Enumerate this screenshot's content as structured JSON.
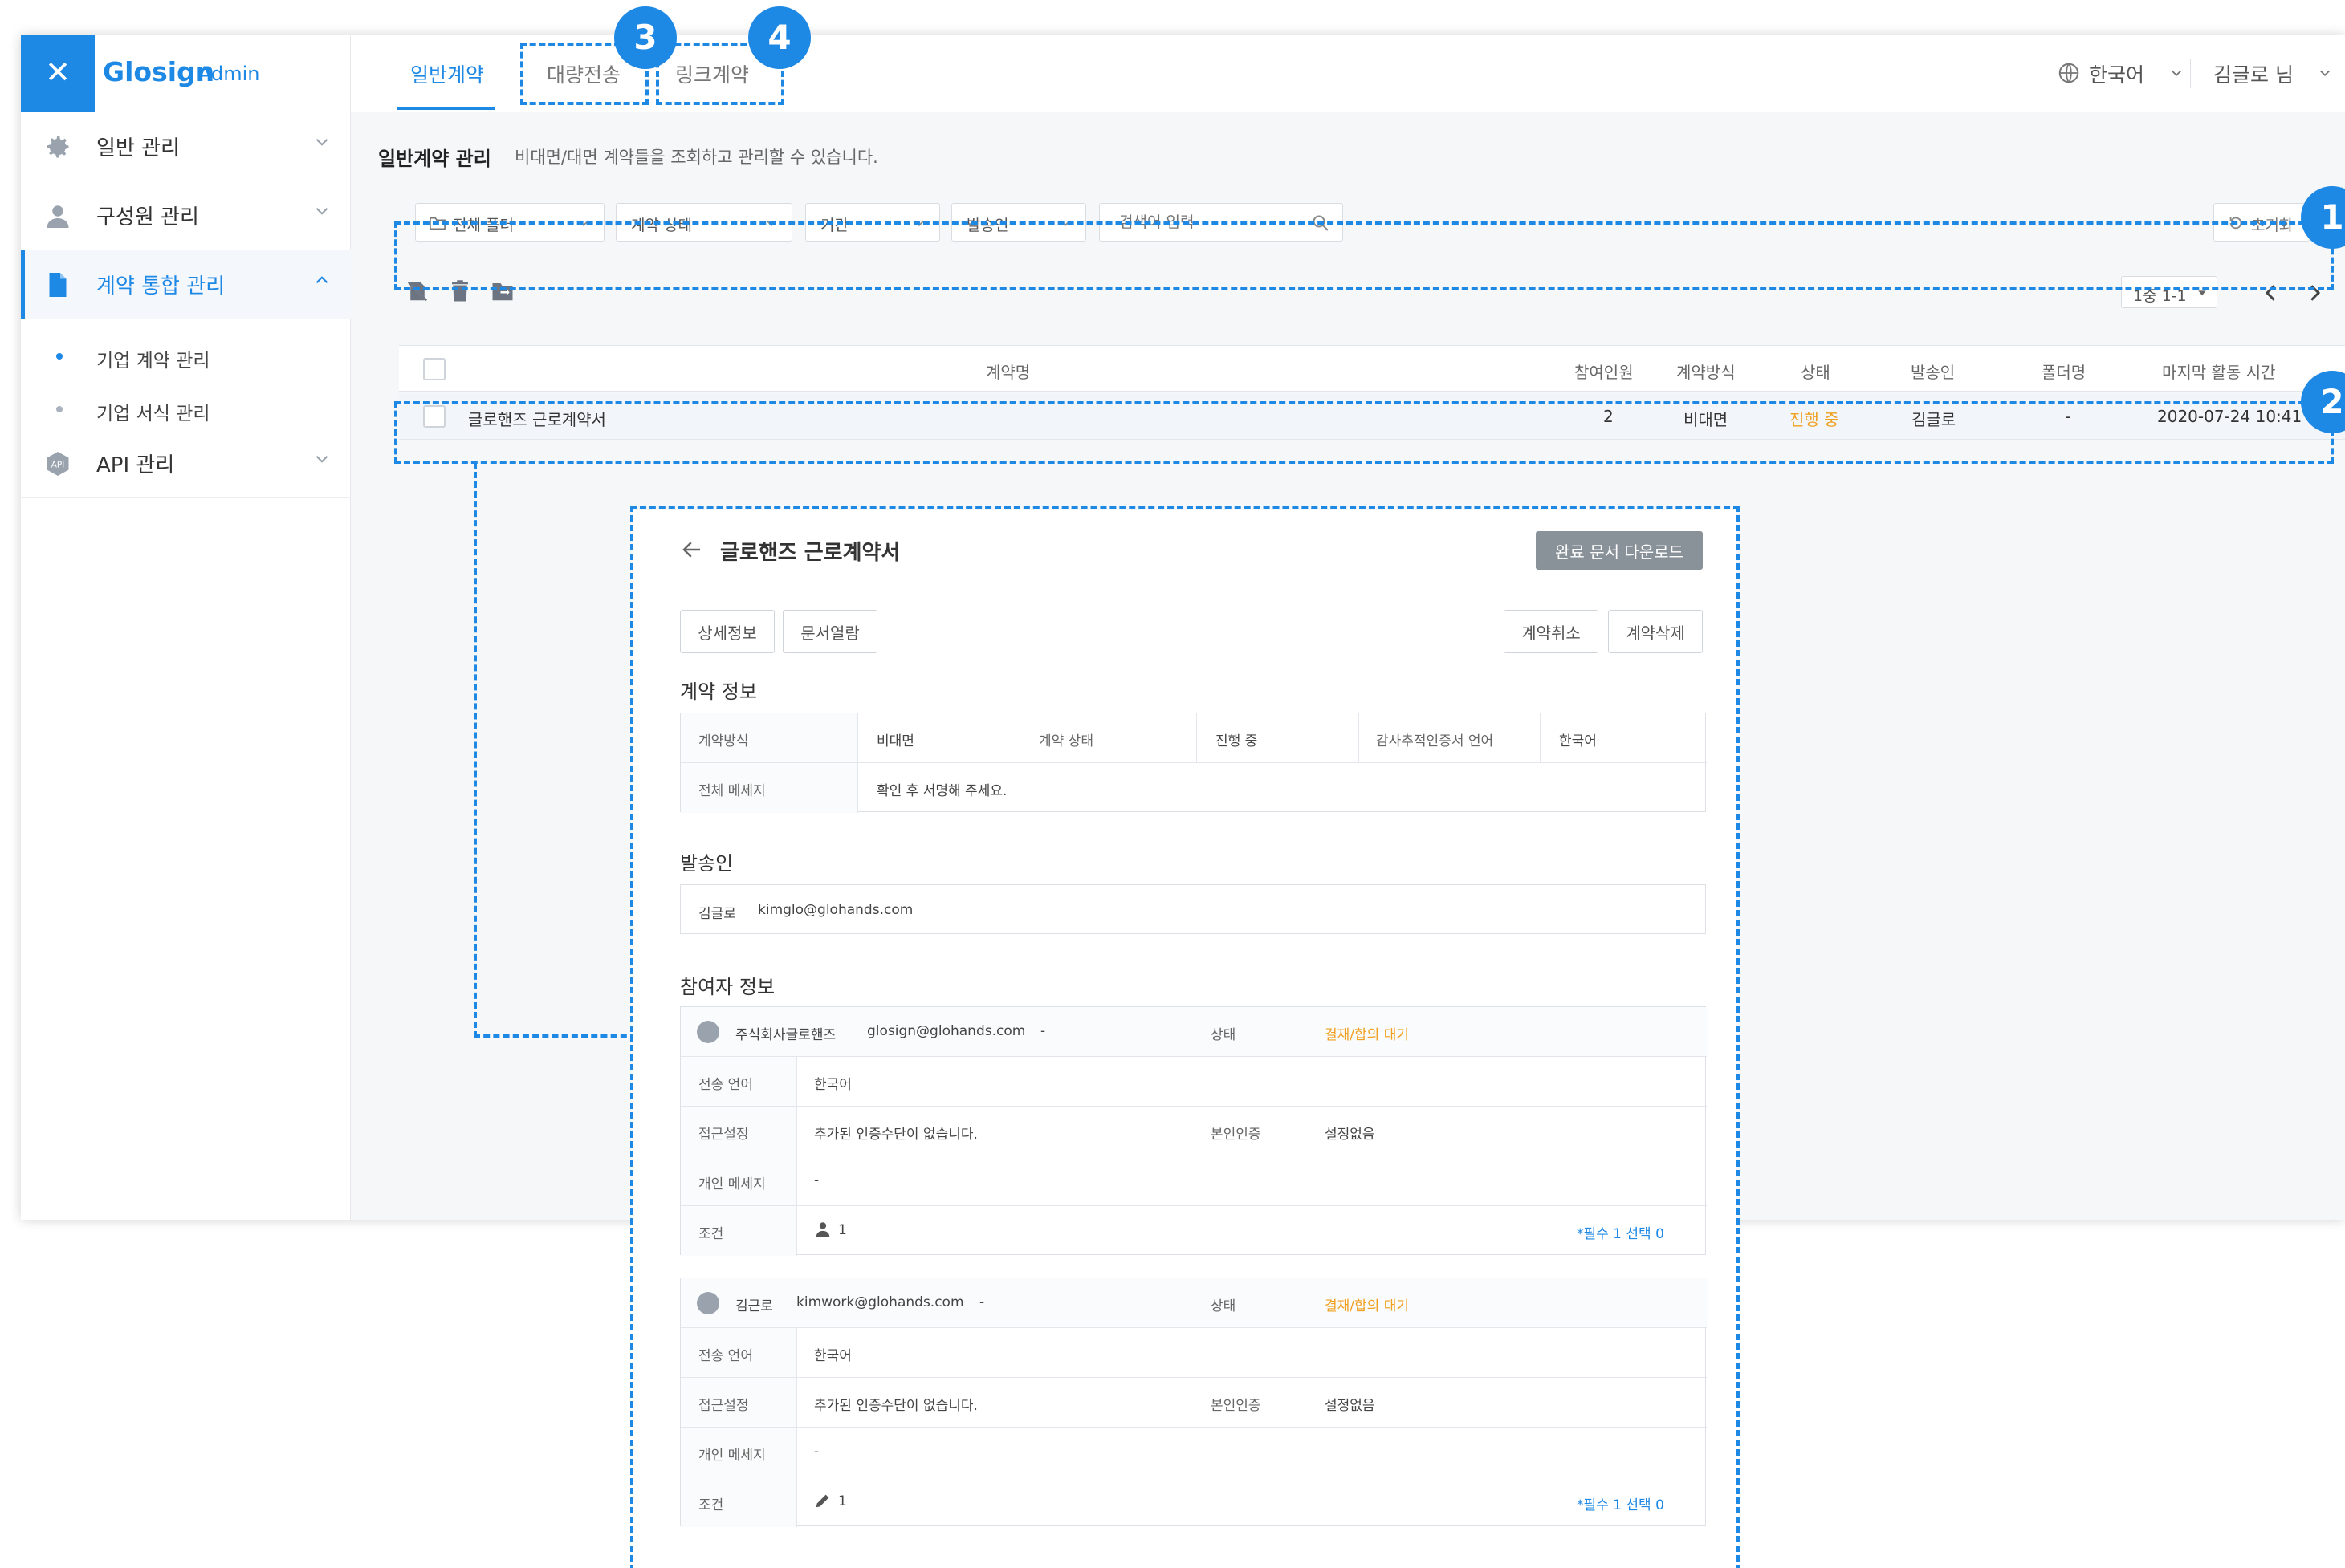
{
  "brand": {
    "close_glyph": "✕",
    "logo": "Glosign",
    "sub": "Admin"
  },
  "sidebar": {
    "items": [
      {
        "label": "일반 관리",
        "icon": "gear-icon"
      },
      {
        "label": "구성원 관리",
        "icon": "person-icon"
      },
      {
        "label": "계약 통합 관리",
        "icon": "document-icon",
        "active": true
      },
      {
        "label": "API 관리",
        "icon": "api-icon"
      }
    ],
    "sub_items": [
      {
        "label": "기업 계약 관리",
        "active": true
      },
      {
        "label": "기업 서식 관리"
      }
    ]
  },
  "topnav": {
    "tabs": [
      "일반계약",
      "대량전송",
      "링크계약"
    ],
    "language": "한국어",
    "user": "김글로 님"
  },
  "page": {
    "title": "일반계약 관리",
    "description": "비대면/대면 계약들을 조회하고 관리할 수 있습니다."
  },
  "filters": {
    "folder": "전체 폴더",
    "status": "계약 상태",
    "period": "기간",
    "sender": "발송인",
    "search_placeholder": "검색어 입력",
    "reset": "초기화"
  },
  "pager": {
    "label": "1중 1-1"
  },
  "table": {
    "headers": [
      "계약명",
      "참여인원",
      "계약방식",
      "상태",
      "발송인",
      "폴더명",
      "마지막 활동 시간"
    ],
    "rows": [
      {
        "name": "글로핸즈 근로계약서",
        "participants": "2",
        "method": "비대면",
        "status": "진행 중",
        "sender": "김글로",
        "folder": "-",
        "last_activity": "2020-07-24 10:41"
      }
    ]
  },
  "annotations": [
    "1",
    "2",
    "3",
    "4"
  ],
  "detail": {
    "title": "글로핸즈 근로계약서",
    "download": "완료 문서 다운로드",
    "buttons": {
      "info": "상세정보",
      "view": "문서열람",
      "cancel": "계약취소",
      "delete": "계약삭제"
    },
    "contract_section": "계약 정보",
    "contract": {
      "method_label": "계약방식",
      "method": "비대면",
      "status_label": "계약 상태",
      "status": "진행 중",
      "cert_lang_label": "감사추적인증서 언어",
      "cert_lang": "한국어",
      "message_label": "전체 메세지",
      "message": "확인 후 서명해 주세요."
    },
    "sender_section": "발송인",
    "sender": {
      "name": "김글로",
      "email": "kimglo@glohands.com"
    },
    "participants_section": "참여자 정보",
    "participants": [
      {
        "name": "주식회사글로핸즈",
        "email": "glosign@glohands.com",
        "dash": "-",
        "status_label": "상태",
        "status": "결재/합의 대기",
        "lang_label": "전송 언어",
        "lang": "한국어",
        "access_label": "접근설정",
        "access": "추가된 인증수단이 없습니다.",
        "verify_label": "본인인증",
        "verify": "설정없음",
        "msg_label": "개인 메세지",
        "msg": "-",
        "cond_label": "조건",
        "cond_count": "1",
        "cond_icon": "person-icon",
        "req": "*필수 1 선택 0"
      },
      {
        "name": "김근로",
        "email": "kimwork@glohands.com",
        "dash": "-",
        "status_label": "상태",
        "status": "결재/합의 대기",
        "lang_label": "전송 언어",
        "lang": "한국어",
        "access_label": "접근설정",
        "access": "추가된 인증수단이 없습니다.",
        "verify_label": "본인인증",
        "verify": "설정없음",
        "msg_label": "개인 메세지",
        "msg": "-",
        "cond_label": "조건",
        "cond_count": "1",
        "cond_icon": "pencil-icon",
        "req": "*필수 1 선택 0"
      }
    ]
  },
  "colors": {
    "accent": "#1e88e5",
    "warning": "#f0a020",
    "download_btn": "#8a9299"
  }
}
